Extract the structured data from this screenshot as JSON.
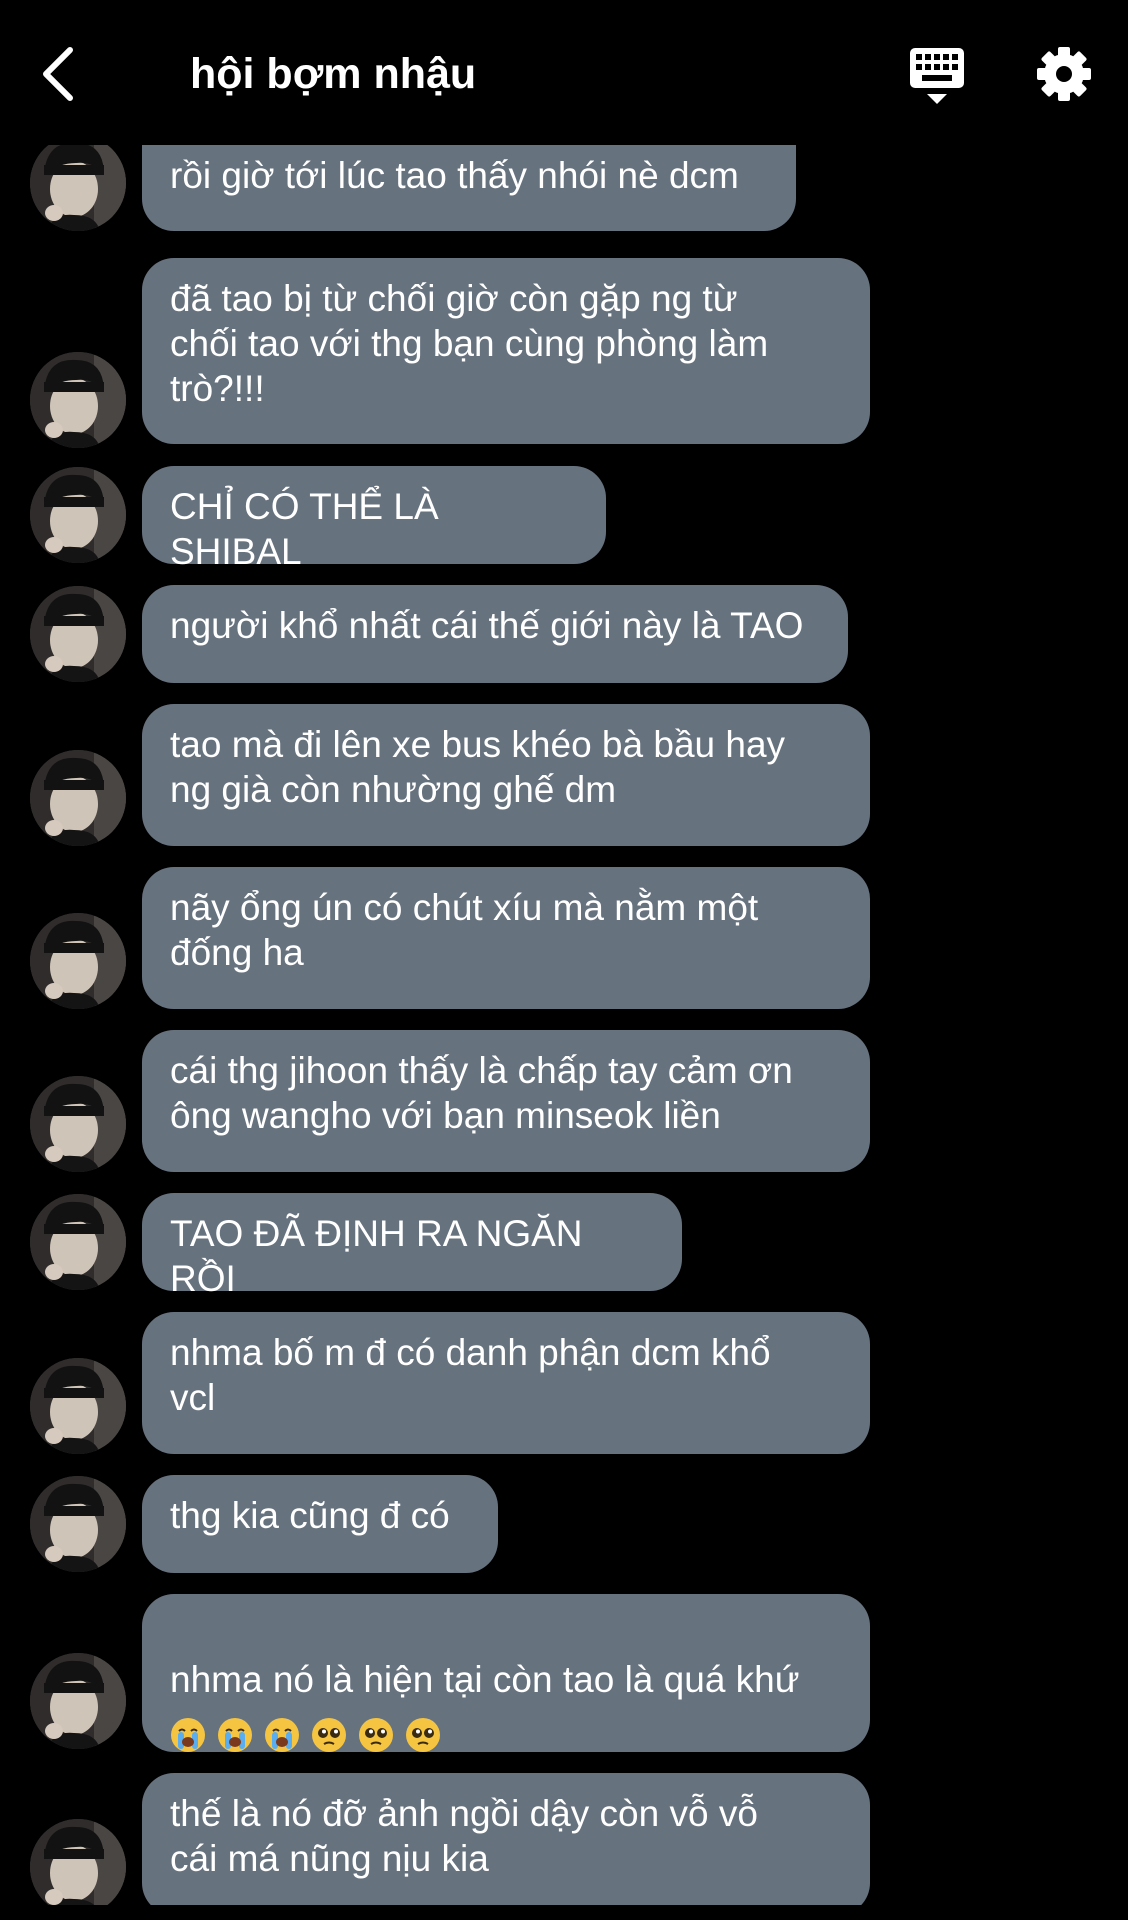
{
  "header": {
    "title": "hội bợm nhậu",
    "back_icon": "chevron-left-icon",
    "keyboard_icon": "keyboard-icon",
    "settings_icon": "gear-icon"
  },
  "colors": {
    "background": "#000000",
    "bubble": "#67727f",
    "text": "#ffffff"
  },
  "messages": [
    {
      "text": "rồi giờ tới lúc tao thấy nhói nè dcm"
    },
    {
      "text": "đã tao bị từ chối giờ còn gặp ng từ\nchối tao với thg bạn cùng phòng làm\ntrò?!!!"
    },
    {
      "text": "CHỈ CÓ THỂ LÀ SHIBAL"
    },
    {
      "text": "người khổ nhất cái thế giới này là TAO"
    },
    {
      "text": "tao mà đi lên xe bus khéo bà bầu hay\nng già còn nhường ghế dm"
    },
    {
      "text": "nãy ổng ún có chút xíu mà nằm một\nđống ha"
    },
    {
      "text": "cái thg jihoon thấy là chấp tay cảm ơn\nông wangho với bạn minseok liền"
    },
    {
      "text": "TAO ĐÃ ĐỊNH RA NGĂN RỒI"
    },
    {
      "text": "nhma bố m đ có danh phận dcm khổ\nvcl"
    },
    {
      "text": "thg kia cũng đ có"
    },
    {
      "text": "nhma nó là hiện tại còn tao là quá khứ",
      "emojis": [
        "crying-face-emoji",
        "crying-face-emoji",
        "crying-face-emoji",
        "pleading-face-emoji",
        "pleading-face-emoji",
        "pleading-face-emoji"
      ]
    },
    {
      "text": "thế là nó đỡ ảnh ngồi dậy còn vỗ vỗ\ncái má nũng nịu kia"
    }
  ]
}
